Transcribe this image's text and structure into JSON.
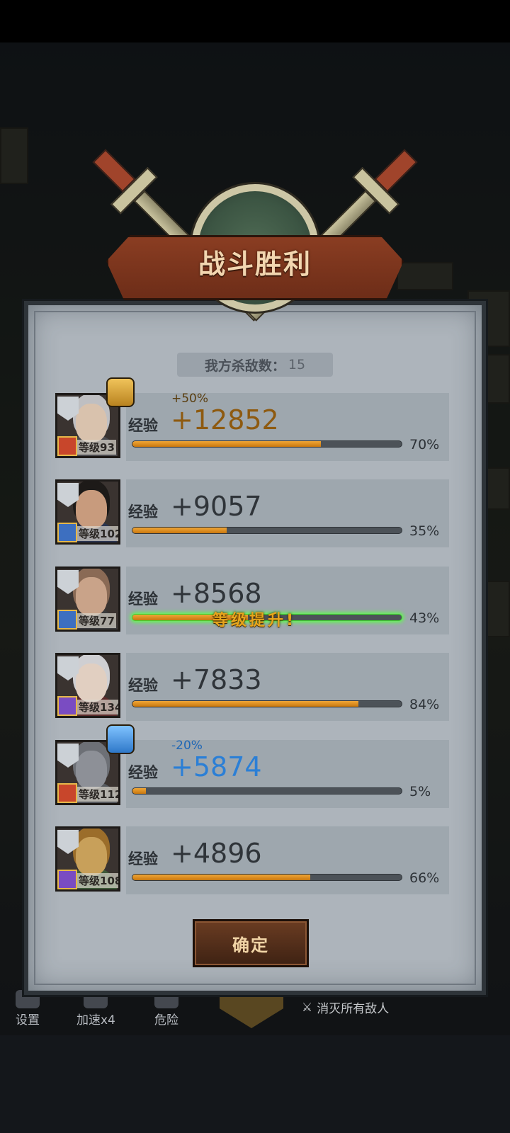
{
  "title": "战斗胜利",
  "kills": {
    "label": "我方杀敌数：",
    "value": "15"
  },
  "exp_label": "经验",
  "level_prefix": "等级",
  "heroes": [
    {
      "level": "93",
      "exp": "+12852",
      "bonus": "+50%",
      "bonus_type": "up",
      "percent": "70%",
      "progress": 0.7,
      "role": "warrior",
      "role_color": "#c8462b",
      "levelup": ""
    },
    {
      "level": "102",
      "exp": "+9057",
      "bonus": "",
      "bonus_type": "",
      "percent": "35%",
      "progress": 0.35,
      "role": "sword",
      "role_color": "#3d6fc0",
      "levelup": ""
    },
    {
      "level": "77",
      "exp": "+8568",
      "bonus": "",
      "bonus_type": "",
      "percent": "43%",
      "progress": 0.43,
      "role": "sword",
      "role_color": "#3d6fc0",
      "levelup": "等级提升!"
    },
    {
      "level": "134",
      "exp": "+7833",
      "bonus": "",
      "bonus_type": "",
      "percent": "84%",
      "progress": 0.84,
      "role": "staff",
      "role_color": "#7a4cc2",
      "levelup": ""
    },
    {
      "level": "112",
      "exp": "+5874",
      "bonus": "-20%",
      "bonus_type": "down",
      "percent": "5%",
      "progress": 0.05,
      "role": "warrior",
      "role_color": "#c8462b",
      "levelup": ""
    },
    {
      "level": "108",
      "exp": "+4896",
      "bonus": "",
      "bonus_type": "",
      "percent": "66%",
      "progress": 0.66,
      "role": "staff",
      "role_color": "#7a4cc2",
      "levelup": ""
    }
  ],
  "confirm_label": "确定",
  "hud": {
    "settings": "设置",
    "speed": "加速x4",
    "danger": "危险",
    "eliminate": "消灭所有敌人"
  },
  "colors": {
    "banner": "#8a3d22",
    "bar_fill": "#e49a2a",
    "levelup_glow": "#5cff4a",
    "bonus_up": "#5a3e0f",
    "bonus_down": "#2b7fd6"
  }
}
